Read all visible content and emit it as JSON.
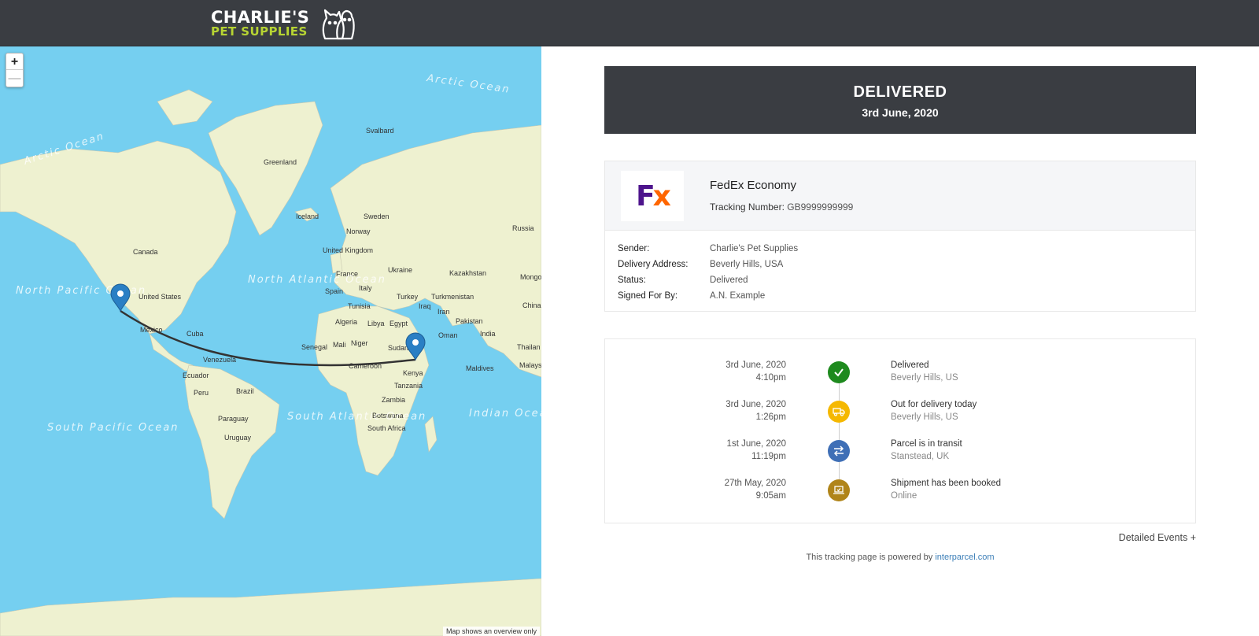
{
  "brand": {
    "line1": "CHARLIE'S",
    "line2": "PET SUPPLIES",
    "accent": "#b7d433"
  },
  "map": {
    "zoom_in": "+",
    "zoom_out": "—",
    "note": "Map shows an overview only",
    "labels": {
      "arctic_ocean_1": "Arctic Ocean",
      "arctic_ocean_2": "Arctic Ocean",
      "greenland": "Greenland",
      "svalbard": "Svalbard",
      "iceland": "Iceland",
      "sweden": "Sweden",
      "norway": "Norway",
      "russia": "Russia",
      "canada": "Canada",
      "united_kingdom": "United Kingdom",
      "ukraine": "Ukraine",
      "kazakhstan": "Kazakhstan",
      "mongolia": "Mongo",
      "france": "France",
      "spain": "Spain",
      "italy": "Italy",
      "turkey": "Turkey",
      "turkmenistan": "Turkmenistan",
      "china": "China",
      "north_pacific_ocean": "North Pacific Ocean",
      "north_atlantic_ocean": "North Atlantic Ocean",
      "united_states": "United States",
      "tunisia": "Tunisia",
      "iraq": "Iraq",
      "iran": "Iran",
      "pakistan": "Pakistan",
      "algeria": "Algeria",
      "libya": "Libya",
      "egypt": "Egypt",
      "mexico": "Mexico",
      "cuba": "Cuba",
      "oman": "Oman",
      "india": "India",
      "thailand": "Thailan",
      "senegal": "Senegal",
      "mali": "Mali",
      "niger": "Niger",
      "sudan": "Sudan",
      "venezuela": "Venezuela",
      "cameroon": "Cameroon",
      "kenya": "Kenya",
      "maldives": "Maldives",
      "malaysia": "Malays",
      "ecuador": "Ecuador",
      "tanzania": "Tanzania",
      "peru": "Peru",
      "brazil": "Brazil",
      "zambia": "Zambia",
      "south_pacific_ocean": "South Pacific Ocean",
      "south_atlantic_ocean": "South Atlantic Ocean",
      "indian_ocean": "Indian Ocean",
      "paraguay": "Paraguay",
      "botswana": "Botswana",
      "uruguay": "Uruguay",
      "south_africa": "South Africa"
    },
    "colors": {
      "water": "#75cff0",
      "land": "#eef1d0",
      "route": "#333333",
      "marker": "#2a7fc4"
    }
  },
  "status": {
    "title": "DELIVERED",
    "date": "3rd June, 2020"
  },
  "carrier": {
    "name": "FedEx Economy",
    "tracking_label": "Tracking Number:",
    "tracking_number": "GB9999999999",
    "logo_f": "F",
    "logo_x": "x"
  },
  "details": [
    {
      "label": "Sender:",
      "value": "Charlie's Pet Supplies"
    },
    {
      "label": "Delivery Address:",
      "value": "Beverly Hills, USA"
    },
    {
      "label": "Status:",
      "value": "Delivered"
    },
    {
      "label": "Signed For By:",
      "value": "A.N. Example"
    }
  ],
  "events": [
    {
      "date": "3rd June, 2020",
      "time": "4:10pm",
      "title": "Delivered",
      "location": "Beverly Hills, US",
      "icon": "check-icon",
      "color": "#1e8a1e"
    },
    {
      "date": "3rd June, 2020",
      "time": "1:26pm",
      "title": "Out for delivery today",
      "location": "Beverly Hills, US",
      "icon": "truck-icon",
      "color": "#f5b800"
    },
    {
      "date": "1st June, 2020",
      "time": "11:19pm",
      "title": "Parcel is in transit",
      "location": "Stanstead, UK",
      "icon": "transfer-icon",
      "color": "#3f6fb6"
    },
    {
      "date": "27th May, 2020",
      "time": "9:05am",
      "title": "Shipment has been booked",
      "location": "Online",
      "icon": "laptop-icon",
      "color": "#b08419"
    }
  ],
  "detailed_events": "Detailed Events +",
  "powered_by": {
    "text": "This tracking page is powered by ",
    "link": "interparcel.com"
  }
}
